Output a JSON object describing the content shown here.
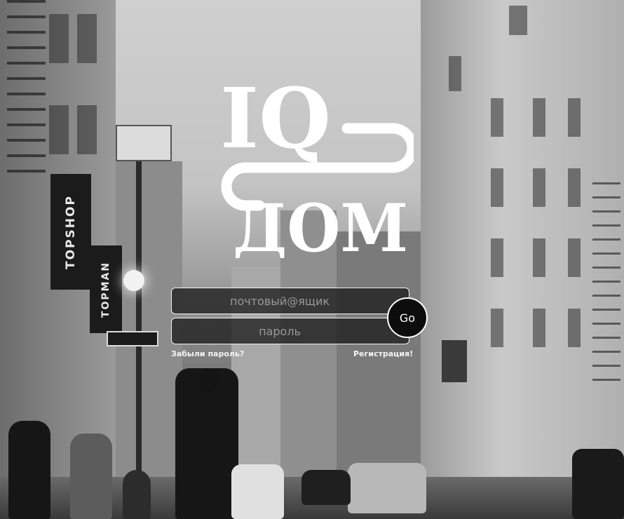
{
  "logo": {
    "text_top": "IQ",
    "text_bottom": "ДОМ"
  },
  "login_form": {
    "email_placeholder": "почтовый@ящик",
    "password_placeholder": "пароль",
    "submit_label": "Go",
    "forgot_password_label": "Забыли пароль?",
    "register_label": "Регистрация!"
  },
  "background": {
    "signs": {
      "topshop": "TOPSHOP",
      "topman": "TOPMAN"
    }
  },
  "colors": {
    "accent": "#ffffff",
    "field_bg": "#1e1e1e",
    "button_bg": "#0d0d0d"
  }
}
